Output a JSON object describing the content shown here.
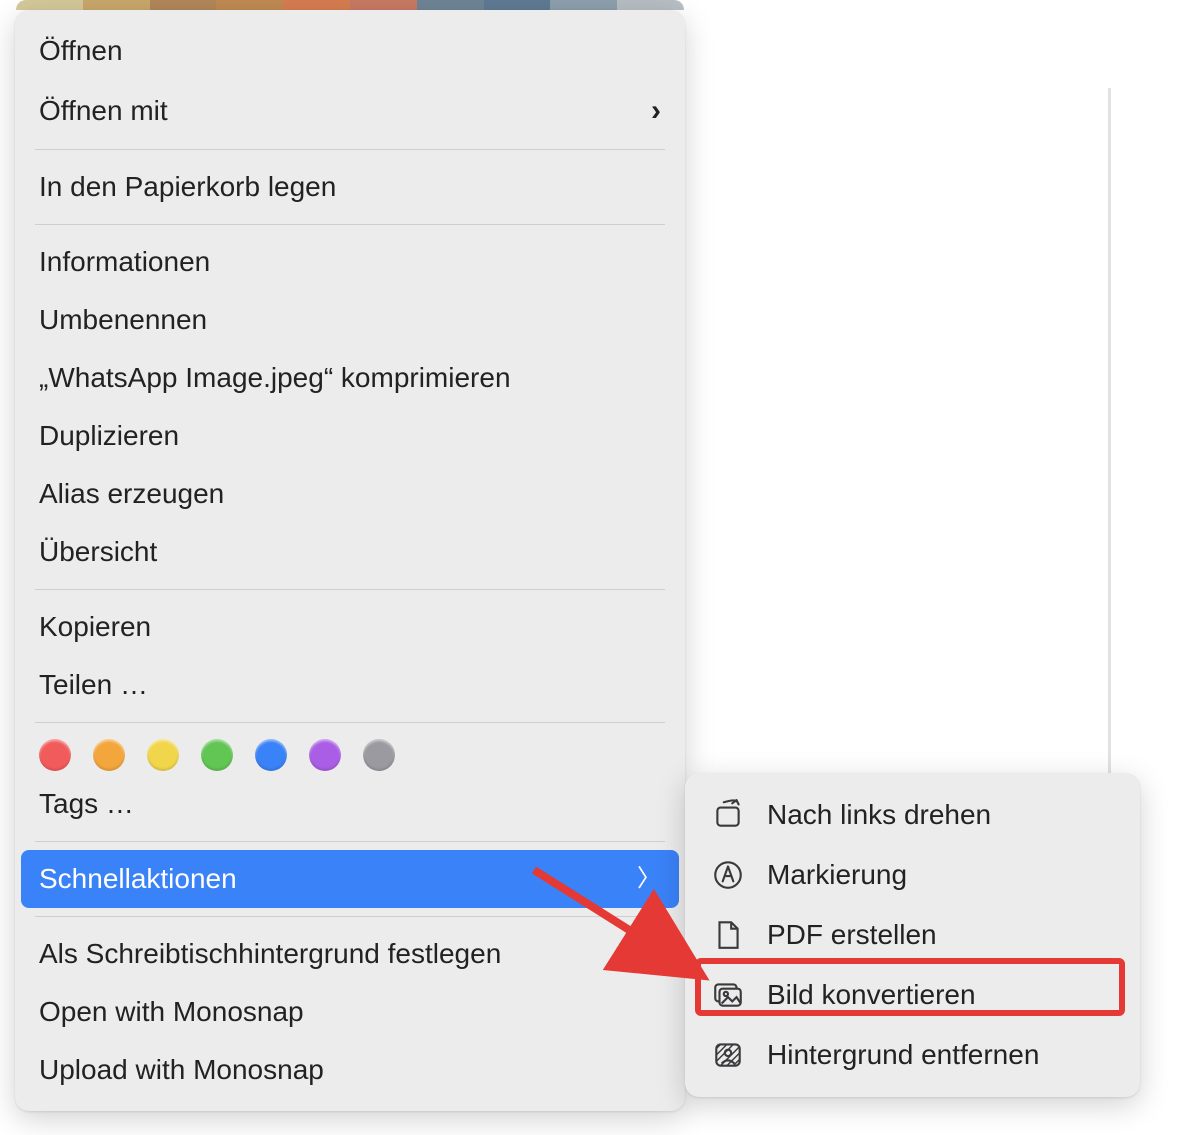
{
  "menu": {
    "open": "Öffnen",
    "openWith": "Öffnen mit",
    "trash": "In den Papierkorb legen",
    "info": "Informationen",
    "rename": "Umbenennen",
    "compress": "„WhatsApp Image.jpeg“ komprimieren",
    "duplicate": "Duplizieren",
    "alias": "Alias erzeugen",
    "quicklook": "Übersicht",
    "copy": "Kopieren",
    "share": "Teilen …",
    "tagsLabel": "Tags …",
    "quickActions": "Schnellaktionen",
    "setWallpaper": "Als Schreibtischhintergrund festlegen",
    "openMonosnap": "Open with Monosnap",
    "uploadMonosnap": "Upload with Monosnap"
  },
  "tagColors": [
    "#f25b5b",
    "#f3a63c",
    "#f1d54a",
    "#61c654",
    "#3a82f7",
    "#a95ee5",
    "#9a9aa0"
  ],
  "submenu": {
    "rotateLeft": "Nach links drehen",
    "markup": "Markierung",
    "createPdf": "PDF erstellen",
    "convertImage": "Bild konvertieren",
    "removeBg": "Hintergrund entfernen"
  },
  "colors": {
    "selection": "#3a82f7",
    "highlight": "#e53935"
  }
}
